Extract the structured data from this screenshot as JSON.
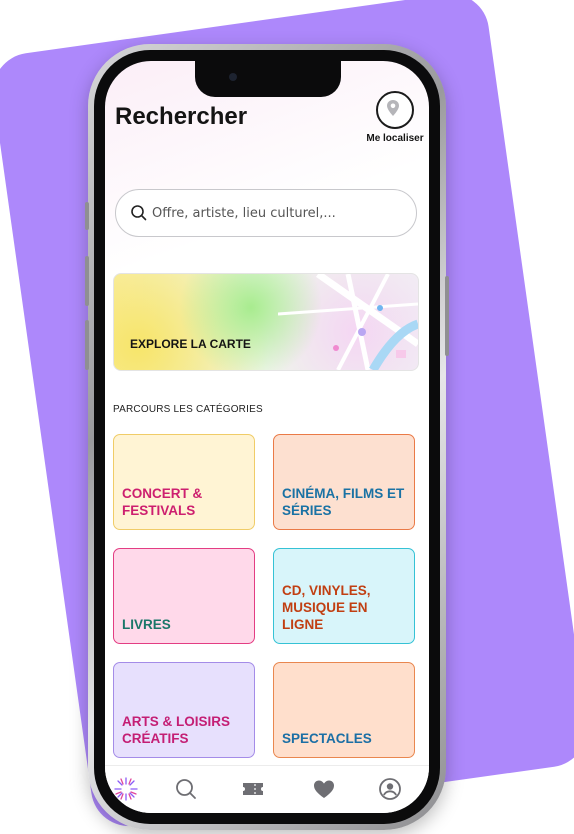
{
  "header": {
    "title": "Rechercher",
    "locate_label": "Me localiser"
  },
  "search": {
    "placeholder": "Offre, artiste, lieu culturel,..."
  },
  "map_banner": {
    "label": "EXPLORE LA CARTE"
  },
  "categories_section": {
    "title": "PARCOURS LES CATÉGORIES",
    "items": [
      {
        "label": "CONCERT & FESTIVALS",
        "bg": "#fff4d4",
        "border": "#f0cc67",
        "text": "#cd1f6f"
      },
      {
        "label": "CINÉMA, FILMS ET SÉRIES",
        "bg": "#fde0d0",
        "border": "#ea7a47",
        "text": "#1a72a4"
      },
      {
        "label": "LIVRES",
        "bg": "#ffd9ea",
        "border": "#e33d83",
        "text": "#1a7769"
      },
      {
        "label": "CD, VINYLES, MUSIQUE EN LIGNE",
        "bg": "#d8f5fa",
        "border": "#35c2d5",
        "text": "#c13f12"
      },
      {
        "label": "ARTS & LOISIRS CRÉATIFS",
        "bg": "#e7e0fd",
        "border": "#a48ce8",
        "text": "#c41e74"
      },
      {
        "label": "SPECTACLES",
        "bg": "#ffdfcc",
        "border": "#e9874f",
        "text": "#1b6fa5"
      }
    ]
  },
  "tabbar": {
    "items": [
      {
        "icon": "sun-logo-icon",
        "active": true
      },
      {
        "icon": "search-icon",
        "active": false
      },
      {
        "icon": "ticket-icon",
        "active": false
      },
      {
        "icon": "heart-icon",
        "active": false
      },
      {
        "icon": "profile-icon",
        "active": false
      }
    ]
  },
  "colors": {
    "background_card": "#ad88fb",
    "text_dark": "#141414",
    "tab_icon": "#6e6e73"
  }
}
